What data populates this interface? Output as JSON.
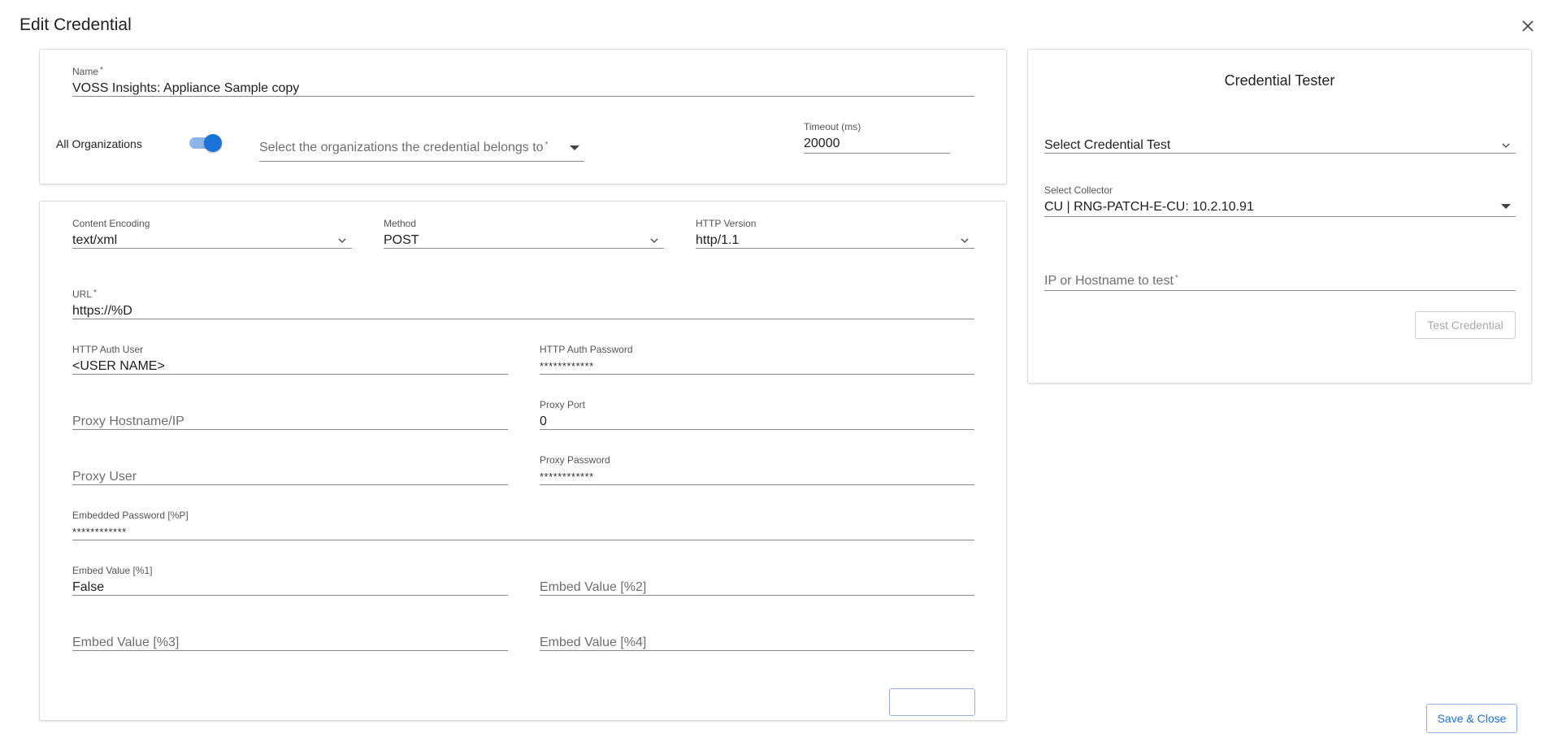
{
  "dialog": {
    "title": "Edit Credential"
  },
  "top": {
    "name_label": "Name",
    "name_value": "VOSS Insights: Appliance Sample copy",
    "all_orgs_label": "All Organizations",
    "all_orgs_on": true,
    "orgs_placeholder": "Select the organizations the credential belongs to",
    "timeout_label": "Timeout (ms)",
    "timeout_value": "20000"
  },
  "main": {
    "content_encoding_label": "Content Encoding",
    "content_encoding_value": "text/xml",
    "method_label": "Method",
    "method_value": "POST",
    "http_version_label": "HTTP Version",
    "http_version_value": "http/1.1",
    "url_label": "URL",
    "url_value": "https://%D",
    "auth_user_label": "HTTP Auth User",
    "auth_user_value": "<USER NAME>",
    "auth_password_label": "HTTP Auth Password",
    "auth_password_value": "************",
    "proxy_host_placeholder": "Proxy Hostname/IP",
    "proxy_port_label": "Proxy Port",
    "proxy_port_value": "0",
    "proxy_user_placeholder": "Proxy User",
    "proxy_password_label": "Proxy Password",
    "proxy_password_value": "************",
    "embedded_password_label": "Embedded Password [%P]",
    "embedded_password_value": "************",
    "embed1_label": "Embed Value [%1]",
    "embed1_value": "False",
    "embed2_placeholder": "Embed Value [%2]",
    "embed3_placeholder": "Embed Value [%3]",
    "embed4_placeholder": "Embed Value [%4]"
  },
  "tester": {
    "title": "Credential Tester",
    "test_select_placeholder": "Select Credential Test",
    "collector_label": "Select Collector",
    "collector_value": "CU | RNG-PATCH-E-CU: 10.2.10.91",
    "host_placeholder": "IP or Hostname to test",
    "test_button": "Test Credential"
  },
  "footer": {
    "save_close": "Save & Close"
  },
  "required_mark": "*"
}
